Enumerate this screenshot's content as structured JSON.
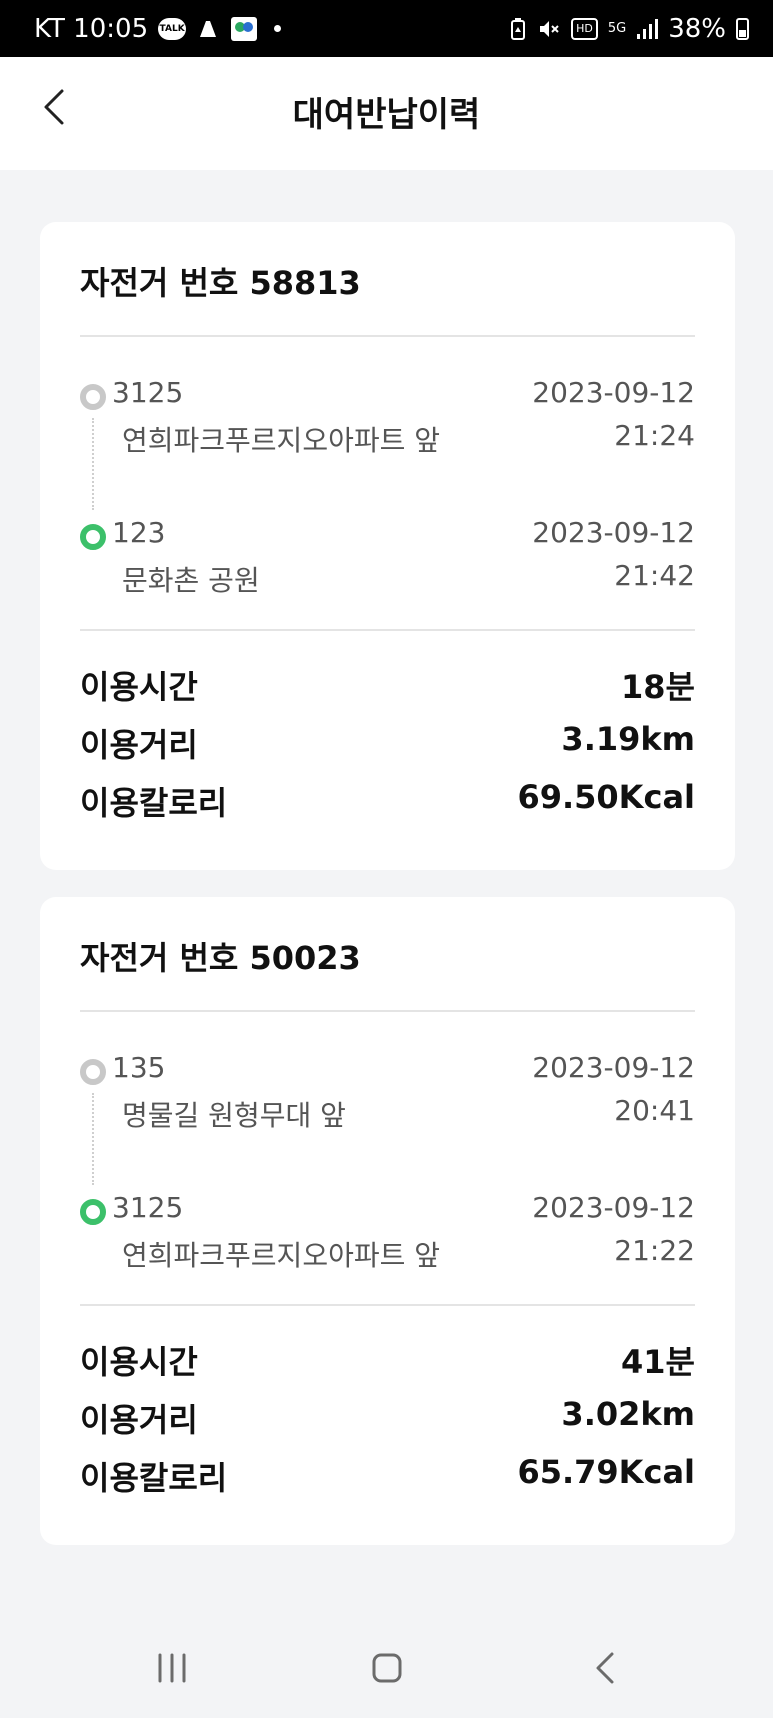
{
  "status_bar": {
    "carrier_time": "KT 10:05",
    "talk_badge": "TALK",
    "hd_badge": "HD",
    "network": "5G",
    "battery": "38%",
    "icons": [
      "talk-icon",
      "app-icon",
      "app-icon-2",
      "dot-icon",
      "battery-saver-icon",
      "mute-icon",
      "hd-icon",
      "5g-icon",
      "signal-icon",
      "battery-icon"
    ]
  },
  "header": {
    "title": "대여반납이력",
    "back_icon": "chevron-left-icon"
  },
  "rentals": [
    {
      "bike_label": "자전거 번호 58813",
      "rent": {
        "station_number": "3125",
        "station_name": "연희파크푸르지오아파트 앞",
        "date": "2023-09-12",
        "time": "21:24"
      },
      "return": {
        "station_number": "123",
        "station_name": "문화촌 공원",
        "date": "2023-09-12",
        "time": "21:42"
      },
      "stats": [
        {
          "label": "이용시간",
          "value": "18분"
        },
        {
          "label": "이용거리",
          "value": "3.19km"
        },
        {
          "label": "이용칼로리",
          "value": "69.50Kcal"
        }
      ]
    },
    {
      "bike_label": "자전거 번호 50023",
      "rent": {
        "station_number": "135",
        "station_name": "명물길 원형무대 앞",
        "date": "2023-09-12",
        "time": "20:41"
      },
      "return": {
        "station_number": "3125",
        "station_name": "연희파크푸르지오아파트 앞",
        "date": "2023-09-12",
        "time": "21:22"
      },
      "stats": [
        {
          "label": "이용시간",
          "value": "41분"
        },
        {
          "label": "이용거리",
          "value": "3.02km"
        },
        {
          "label": "이용칼로리",
          "value": "65.79Kcal"
        }
      ]
    }
  ],
  "colors": {
    "accent_green": "#3cc06a",
    "rent_dot_gray": "#c8c8c8",
    "background": "#f3f4f6"
  },
  "nav_bar": {
    "icons": [
      "recents-icon",
      "home-icon",
      "back-icon"
    ]
  }
}
